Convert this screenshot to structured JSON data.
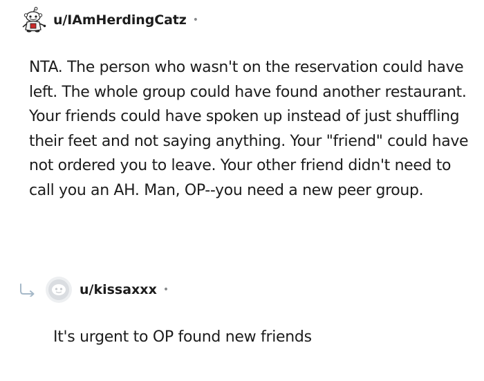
{
  "comment": {
    "avatar_icon": "reddit-avatar-icon",
    "username": "u/IAmHerdingCatz",
    "separator": "•",
    "body": "NTA. The person who wasn't on the reservation could have left. The whole group could have found another restaurant. Your friends could have spoken up instead of just shuffling their feet and not saying anything. Your \"friend\" could have not ordered you to leave. Your other friend didn't need to call you an AH. Man, OP--you need a new peer group."
  },
  "reply": {
    "arrow_icon": "reply-arrow-icon",
    "avatar_icon": "default-avatar-icon",
    "username": "u/kissaxxx",
    "separator": "•",
    "body": "It's urgent to OP found new friends"
  },
  "colors": {
    "text": "#1c1c1c",
    "meta": "#878a8c",
    "reply_arrow": "#a5b8c8",
    "background": "#ffffff"
  }
}
